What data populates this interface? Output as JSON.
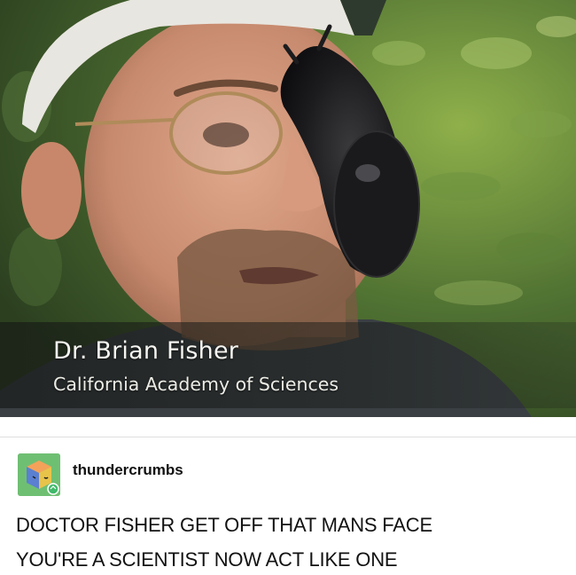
{
  "video": {
    "caption_name": "Dr. Brian Fisher",
    "caption_org": "California Academy of Sciences"
  },
  "post": {
    "username": "thundercrumbs",
    "text_line_1": "DOCTOR FISHER GET OFF THAT MANS FACE",
    "text_line_2": "YOU'RE A SCIENTIST NOW ACT LIKE ONE"
  },
  "colors": {
    "avatar_bg": "#6fbf73",
    "foliage": "#4a6b32",
    "slug": "#1c1c1c"
  },
  "icons": {
    "avatar": "isometric-box-icon",
    "reblog_badge": "reblog-icon"
  }
}
